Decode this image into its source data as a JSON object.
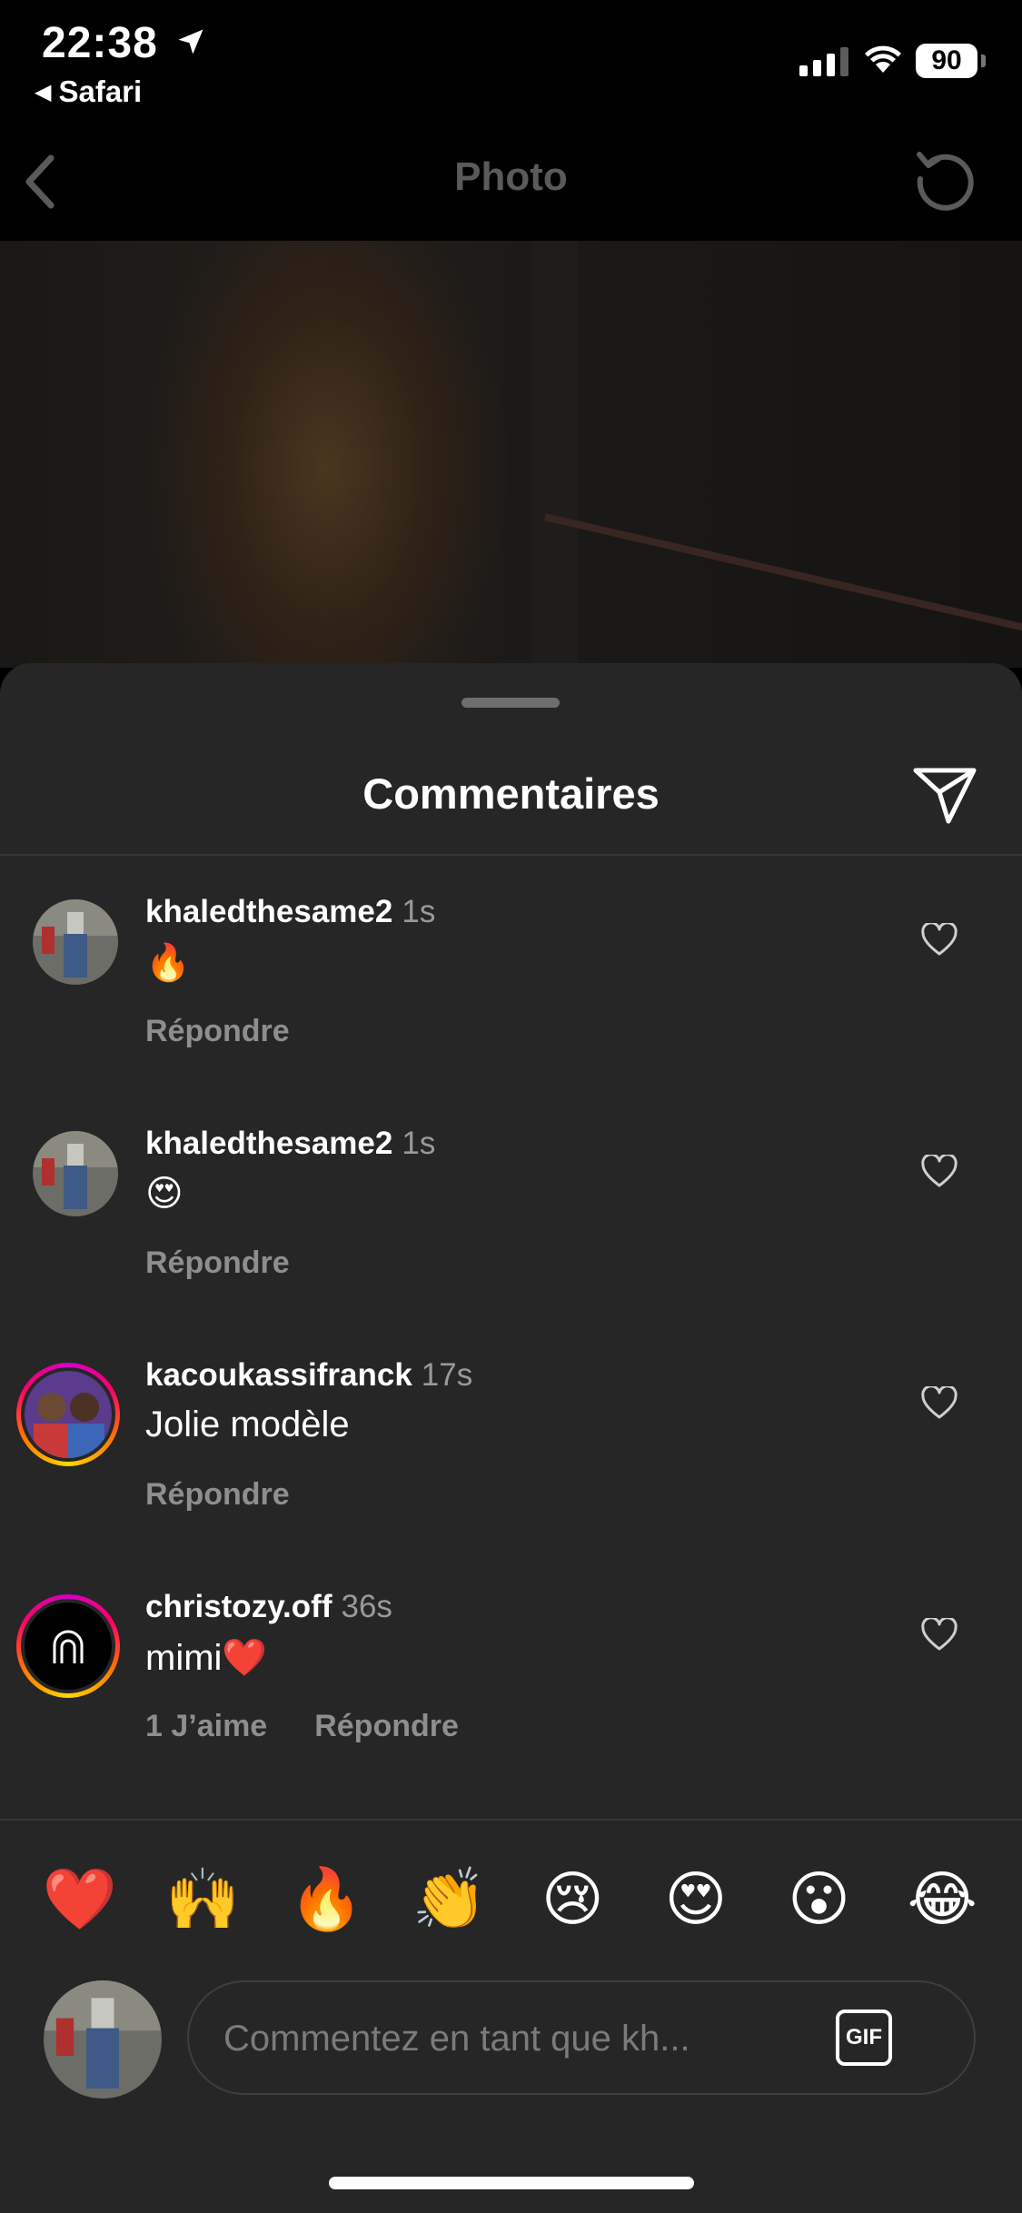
{
  "status_bar": {
    "time": "22:38",
    "back_app": "Safari",
    "battery": "90"
  },
  "nav": {
    "title": "Photo"
  },
  "sheet": {
    "title": "Commentaires"
  },
  "comments": [
    {
      "username": "khaledthesame2",
      "time": "1s",
      "text": "🔥",
      "likes": "",
      "reply": "Répondre",
      "ringed": false
    },
    {
      "username": "khaledthesame2",
      "time": "1s",
      "text": "😍",
      "likes": "",
      "reply": "Répondre",
      "ringed": false
    },
    {
      "username": "kacoukassifranck",
      "time": "17s",
      "text": "Jolie modèle",
      "likes": "",
      "reply": "Répondre",
      "ringed": true
    },
    {
      "username": "christozy.off",
      "time": "36s",
      "text": "mimi❤️",
      "likes": "1 J’aime",
      "reply": "Répondre",
      "ringed": true
    }
  ],
  "emoji_bar": [
    "❤️",
    "🙌",
    "🔥",
    "👏",
    "😢",
    "😍",
    "😮",
    "😂"
  ],
  "composer": {
    "placeholder": "Commentez en tant que kh...",
    "gif_label": "GIF"
  },
  "colors": {
    "sheet_bg": "#262626",
    "muted_text": "#8e8e8e",
    "nav_title": "#5a5a5a"
  },
  "icons": {
    "nav_back": "chevron-left-icon",
    "refresh": "refresh-icon",
    "share": "paper-plane-icon",
    "like": "heart-outline-icon"
  }
}
